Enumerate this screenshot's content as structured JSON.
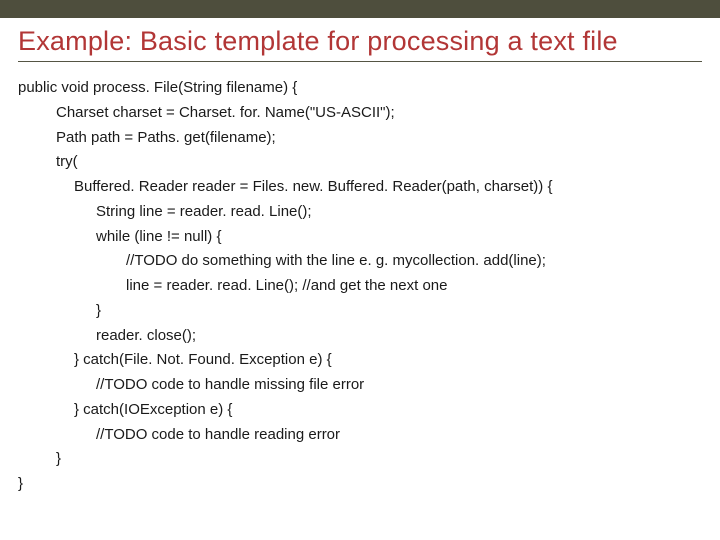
{
  "title": "Example: Basic template for processing a text file",
  "code": {
    "l0": "public void process. File(String filename)  {",
    "l1": "Charset charset = Charset. for. Name(\"US-ASCII\");",
    "l2": "Path path = Paths. get(filename);",
    "l3": "try(",
    "l4": "Buffered. Reader reader = Files. new. Buffered. Reader(path, charset)) {",
    "l5": "String line = reader. read. Line();",
    "l6": "while (line != null) {",
    "l7": "//TODO do something with the line e. g. mycollection. add(line);",
    "l8": "line = reader. read. Line(); //and get the next one",
    "l9": "}",
    "l10": "reader. close();",
    "l11": "} catch(File. Not. Found. Exception e) {",
    "l12": "//TODO code to handle missing file error",
    "l13": "} catch(IOException e) {",
    "l14": "//TODO code to handle reading error",
    "l15": "}",
    "l16": "}"
  }
}
